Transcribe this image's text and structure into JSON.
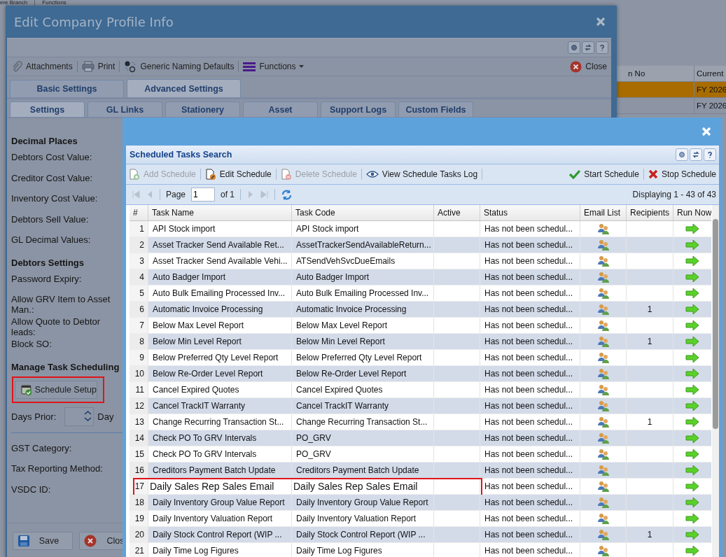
{
  "background_app": {
    "toolbar": [
      "ere Branch",
      "Functions"
    ],
    "grid": {
      "columns": [
        "n No",
        "Current"
      ],
      "rows": [
        {
          "cells": [
            "",
            "FY 2026"
          ],
          "selected": true
        },
        {
          "cells": [
            "",
            "FY 2026"
          ],
          "selected": false
        }
      ]
    }
  },
  "company_dialog": {
    "title": "Edit Company Profile Info",
    "toolbar": [
      "Attachments",
      "Print",
      "Generic Naming Defaults",
      "Functions"
    ],
    "close": "Close",
    "tabs": [
      {
        "label": "Basic Settings",
        "selected": false
      },
      {
        "label": "Advanced Settings",
        "selected": true
      }
    ],
    "subtabs": [
      {
        "label": "Settings",
        "selected": true
      },
      {
        "label": "GL Links",
        "selected": false
      },
      {
        "label": "Stationery",
        "selected": false
      },
      {
        "label": "Asset",
        "selected": false
      },
      {
        "label": "Support Logs",
        "selected": false
      },
      {
        "label": "Custom Fields",
        "selected": false
      }
    ],
    "form": [
      {
        "kind": "heading",
        "label": "Decimal Places"
      },
      {
        "kind": "field",
        "label": "Debtors Cost Value:"
      },
      {
        "kind": "field",
        "label": "Creditor Cost Value:"
      },
      {
        "kind": "field",
        "label": "Inventory Cost Value:"
      },
      {
        "kind": "field",
        "label": "Debtors Sell Value:"
      },
      {
        "kind": "field",
        "label": "GL Decimal Values:"
      },
      {
        "kind": "heading",
        "label": "Debtors Settings"
      },
      {
        "kind": "field",
        "label": "Password Expiry:"
      },
      {
        "kind": "field",
        "label": "Allow GRV Item to Asset Man.:"
      },
      {
        "kind": "field",
        "label": "Allow Quote to Debtor leads:"
      },
      {
        "kind": "field",
        "label": "Block SO:"
      },
      {
        "kind": "heading",
        "label": "Manage Task Scheduling"
      },
      {
        "kind": "button",
        "label": "Schedule Setup",
        "highlighted": true
      },
      {
        "kind": "spinner",
        "label": "Days Prior:",
        "suffix": "Day"
      },
      {
        "kind": "divider"
      },
      {
        "kind": "field",
        "label": "GST Category:"
      },
      {
        "kind": "field",
        "label": "Tax Reporting Method:"
      },
      {
        "kind": "field",
        "label": "VSDC ID:"
      }
    ],
    "footer_buttons": [
      "Save",
      "Clos"
    ]
  },
  "schedule_dialog": {
    "title": "Scheduled Tasks Search",
    "toolbar": [
      {
        "label": "Add Schedule",
        "disabled": true
      },
      {
        "label": "Edit Schedule",
        "disabled": false
      },
      {
        "label": "Delete Schedule",
        "disabled": true
      },
      {
        "label": "View Schedule Tasks Log",
        "disabled": false
      },
      {
        "label": "Start Schedule",
        "disabled": false
      },
      {
        "label": "Stop Schedule",
        "disabled": false
      }
    ],
    "pager": {
      "page_label": "Page",
      "page": "1",
      "of": "of 1",
      "display": "Displaying 1 - 43 of 43"
    },
    "columns": [
      "#",
      "Task Name",
      "Task Code",
      "Active",
      "Status",
      "Email List",
      "Recipients",
      "Run Now"
    ],
    "rows": [
      {
        "num": "1",
        "name": "API Stock import",
        "code": "API Stock import",
        "status": "Has not been schedul...",
        "recipients": "",
        "highlighted": false
      },
      {
        "num": "2",
        "name": "Asset Tracker Send Available Ret...",
        "code": "AssetTrackerSendAvailableReturn...",
        "status": "Has not been schedul...",
        "recipients": "",
        "highlighted": false
      },
      {
        "num": "3",
        "name": "Asset Tracker Send Available Vehi...",
        "code": "ATSendVehSvcDueEmails",
        "status": "Has not been schedul...",
        "recipients": "",
        "highlighted": false
      },
      {
        "num": "4",
        "name": "Auto Badger Import",
        "code": "Auto Badger Import",
        "status": "Has not been schedul...",
        "recipients": "",
        "highlighted": false
      },
      {
        "num": "5",
        "name": "Auto Bulk Emailing Processed Inv...",
        "code": "Auto Bulk Emailing Processed Inv...",
        "status": "Has not been schedul...",
        "recipients": "",
        "highlighted": false
      },
      {
        "num": "6",
        "name": "Automatic Invoice Processing",
        "code": "Automatic Invoice Processing",
        "status": "Has not been schedul...",
        "recipients": "1",
        "highlighted": false
      },
      {
        "num": "7",
        "name": "Below Max Level Report",
        "code": "Below Max Level Report",
        "status": "Has not been schedul...",
        "recipients": "",
        "highlighted": false
      },
      {
        "num": "8",
        "name": "Below Min Level Report",
        "code": "Below Min Level Report",
        "status": "Has not been schedul...",
        "recipients": "1",
        "highlighted": false
      },
      {
        "num": "9",
        "name": "Below Preferred Qty Level Report",
        "code": "Below Preferred Qty Level Report",
        "status": "Has not been schedul...",
        "recipients": "",
        "highlighted": false
      },
      {
        "num": "10",
        "name": "Below Re-Order Level Report",
        "code": "Below Re-Order Level Report",
        "status": "Has not been schedul...",
        "recipients": "",
        "highlighted": false
      },
      {
        "num": "11",
        "name": "Cancel Expired Quotes",
        "code": "Cancel Expired Quotes",
        "status": "Has not been schedul...",
        "recipients": "",
        "highlighted": false
      },
      {
        "num": "12",
        "name": "Cancel TrackIT Warranty",
        "code": "Cancel TrackIT Warranty",
        "status": "Has not been schedul...",
        "recipients": "",
        "highlighted": false
      },
      {
        "num": "13",
        "name": "Change Recurring Transaction St...",
        "code": "Change Recurring Transaction St...",
        "status": "Has not been schedul...",
        "recipients": "1",
        "highlighted": false
      },
      {
        "num": "14",
        "name": "Check PO To GRV Intervals",
        "code": "PO_GRV",
        "status": "Has not been schedul...",
        "recipients": "",
        "highlighted": false
      },
      {
        "num": "15",
        "name": "Check PO To GRV Intervals",
        "code": "PO_GRV",
        "status": "Has not been schedul...",
        "recipients": "",
        "highlighted": false
      },
      {
        "num": "16",
        "name": "Creditors Payment Batch Update",
        "code": "Creditors Payment Batch Update",
        "status": "Has not been schedul...",
        "recipients": "",
        "highlighted": false
      },
      {
        "num": "17",
        "name": "Daily Sales Rep Sales Email",
        "code": "Daily Sales Rep Sales Email",
        "status": "Has not been schedul...",
        "recipients": "",
        "highlighted": true
      },
      {
        "num": "18",
        "name": "Daily Inventory Group Value Report",
        "code": "Daily Inventory Group Value Report",
        "status": "Has not been schedul...",
        "recipients": "",
        "highlighted": false
      },
      {
        "num": "19",
        "name": "Daily Inventory Valuation Report",
        "code": "Daily Inventory Valuation Report",
        "status": "Has not been schedul...",
        "recipients": "",
        "highlighted": false
      },
      {
        "num": "20",
        "name": "Daily Stock Control Report (WIP ...",
        "code": "Daily Stock Control Report (WIP ...",
        "status": "Has not been schedul...",
        "recipients": "1",
        "highlighted": false
      },
      {
        "num": "21",
        "name": "Daily Time Log Figures",
        "code": "Daily Time Log Figures",
        "status": "Has not been schedul...",
        "recipients": "",
        "highlighted": false
      }
    ]
  }
}
